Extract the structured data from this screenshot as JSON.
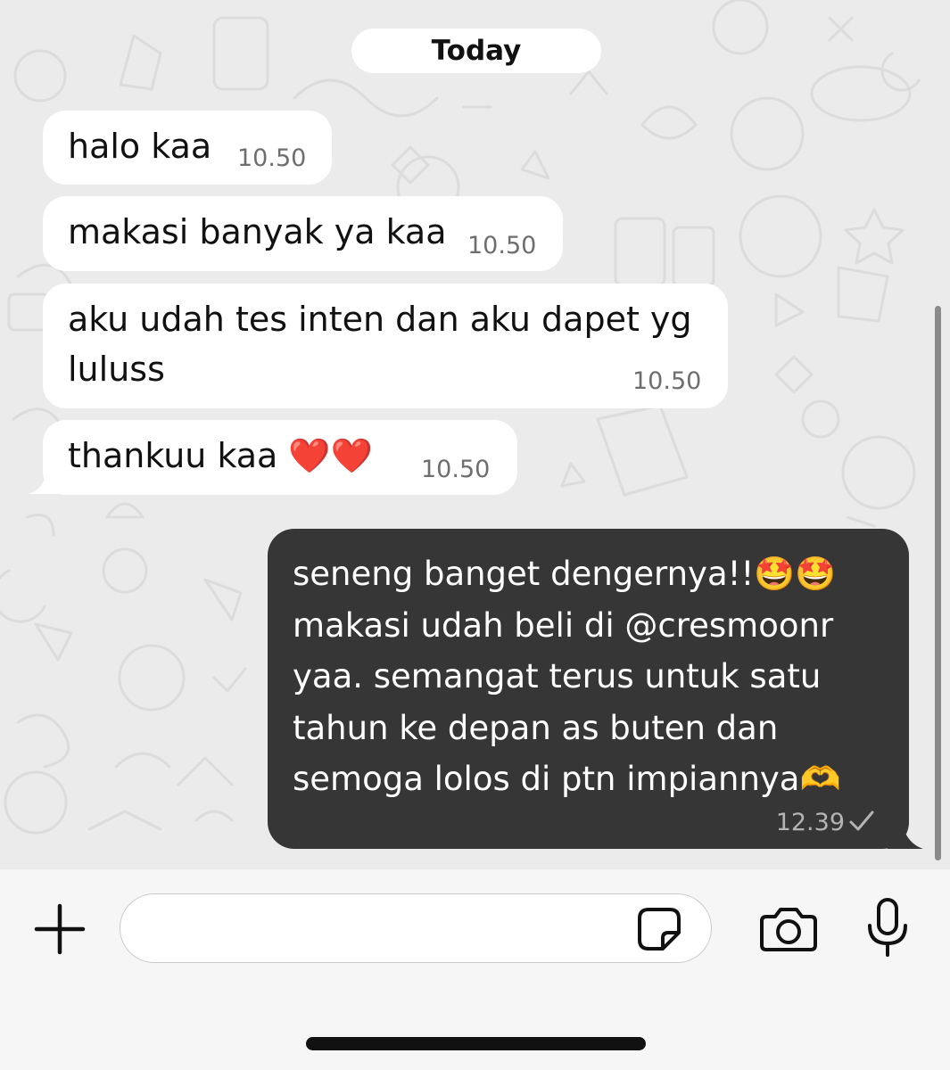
{
  "date_divider": "Today",
  "messages": [
    {
      "direction": "incoming",
      "text": "halo kaa",
      "time": "10.50"
    },
    {
      "direction": "incoming",
      "text": "makasi banyak ya kaa",
      "time": "10.50"
    },
    {
      "direction": "incoming",
      "text": "aku udah tes inten dan aku dapet yg",
      "text_line2": "luluss",
      "time": "10.50"
    },
    {
      "direction": "incoming",
      "text": "thankuu kaa ❤️❤️",
      "time": "10.50"
    },
    {
      "direction": "outgoing",
      "text": "seneng banget dengernya!!🤩🤩\nmakasi udah beli di @cresmoonr\nyaa. semangat terus untuk satu\ntahun ke depan as buten dan\nsemoga lolos di ptn impiannya🫶",
      "time": "12.39",
      "status_icon": "single-check-icon"
    }
  ],
  "composer": {
    "placeholder": "",
    "icons": [
      "plus-icon",
      "sticker-icon",
      "camera-icon",
      "microphone-icon"
    ]
  },
  "colors": {
    "chat_background": "#ebebeb",
    "incoming_bubble": "#ffffff",
    "outgoing_bubble": "#363636",
    "timestamp_incoming": "#6e6e6e",
    "timestamp_outgoing": "#b4b4b4"
  }
}
